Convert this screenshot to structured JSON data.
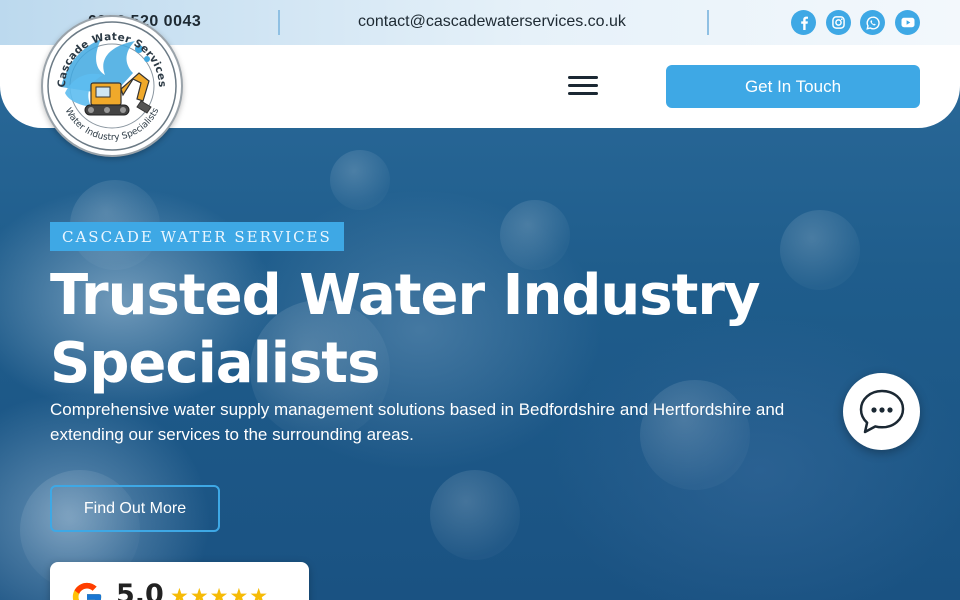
{
  "topbar": {
    "phone": "0333 520 0043",
    "email": "contact@cascadewaterservices.co.uk",
    "social": [
      {
        "icon": "facebook-icon",
        "glyph": "f"
      },
      {
        "icon": "instagram-icon",
        "glyph": ""
      },
      {
        "icon": "whatsapp-icon",
        "glyph": ""
      },
      {
        "icon": "youtube-icon",
        "glyph": ""
      }
    ]
  },
  "logo": {
    "top_text": "Cascade Water Services",
    "bottom_text": "Water Industry Specialists"
  },
  "header": {
    "cta_label": "Get In Touch"
  },
  "hero": {
    "badge": "CASCADE WATER SERVICES",
    "title": "Trusted Water Industry Specialists",
    "subtitle": "Comprehensive water supply management solutions based in Bedfordshire and Hertfordshire and extending our services to the surrounding areas.",
    "button_label": "Find Out More"
  },
  "review": {
    "rating": "5.0",
    "stars": "★★★★★"
  },
  "colors": {
    "accent": "#3ea8e5",
    "hero_bg": "#1f5f8f",
    "text_dark": "#1e2a33",
    "star": "#f6bb06"
  }
}
